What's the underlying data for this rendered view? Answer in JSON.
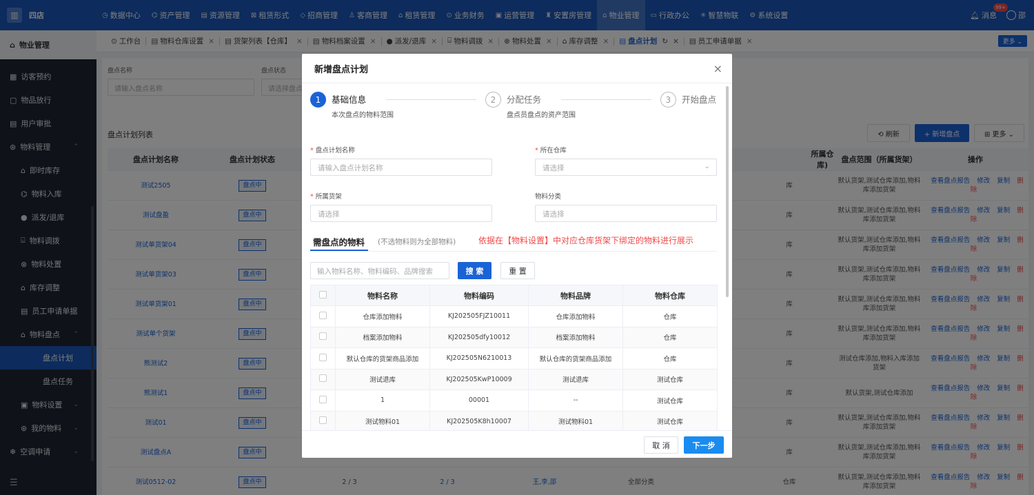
{
  "brand": {
    "name": "四店"
  },
  "topnav": [
    {
      "label": "数据中心",
      "icon": "◷"
    },
    {
      "label": "资产管理",
      "icon": "⌬"
    },
    {
      "label": "资源管理",
      "icon": "▤"
    },
    {
      "label": "租赁形式",
      "icon": "⊠"
    },
    {
      "label": "招商管理",
      "icon": "◇"
    },
    {
      "label": "客商管理",
      "icon": "♙"
    },
    {
      "label": "租赁管理",
      "icon": "⌂"
    },
    {
      "label": "业务财务",
      "icon": "⊙"
    },
    {
      "label": "运营管理",
      "icon": "▣"
    },
    {
      "label": "安置房管理",
      "icon": "♜"
    },
    {
      "label": "物业管理",
      "icon": "⌂",
      "active": true
    },
    {
      "label": "行政办公",
      "icon": "▭"
    },
    {
      "label": "智慧物联",
      "icon": "✳"
    },
    {
      "label": "系统设置",
      "icon": "⚙"
    }
  ],
  "topright": {
    "messages": "消息",
    "badge": "99+",
    "user": "邵"
  },
  "sidebar": {
    "title": "物业管理",
    "items": [
      {
        "label": "访客预约",
        "icon": "▦",
        "level": 1
      },
      {
        "label": "物品放行",
        "icon": "▢",
        "level": 1
      },
      {
        "label": "用户审批",
        "icon": "▤",
        "level": 1
      },
      {
        "label": "物料管理",
        "icon": "⊛",
        "level": 1,
        "caret": "⌃"
      },
      {
        "label": "即时库存",
        "icon": "⌂",
        "level": 2
      },
      {
        "label": "物料入库",
        "icon": "⌬",
        "level": 2
      },
      {
        "label": "派发/退库",
        "icon": "●",
        "level": 2
      },
      {
        "label": "物料调拨",
        "icon": "⌸",
        "level": 2
      },
      {
        "label": "物料处置",
        "icon": "⊗",
        "level": 2
      },
      {
        "label": "库存调整",
        "icon": "⌂",
        "level": 2
      },
      {
        "label": "员工申请单据",
        "icon": "▤",
        "level": 2
      },
      {
        "label": "物料盘点",
        "icon": "⌂",
        "level": 2,
        "caret": "⌃"
      },
      {
        "label": "盘点计划",
        "level": 3,
        "active": true
      },
      {
        "label": "盘点任务",
        "level": 3
      },
      {
        "label": "物料设置",
        "icon": "▣",
        "level": 2,
        "caret": "⌄"
      },
      {
        "label": "我的物料",
        "icon": "⊛",
        "level": 2,
        "caret": "⌄"
      },
      {
        "label": "空调申请",
        "icon": "❄",
        "level": 1,
        "caret": "⌄"
      }
    ]
  },
  "tabs": [
    {
      "label": "工作台",
      "icon": "⊙"
    },
    {
      "label": "物料仓库设置",
      "icon": "▤",
      "close": "×"
    },
    {
      "label": "货架列表【仓库】",
      "icon": "▤",
      "close": "×"
    },
    {
      "label": "物料档案设置",
      "icon": "▤",
      "close": "×"
    },
    {
      "label": "派发/退库",
      "icon": "●",
      "close": "×"
    },
    {
      "label": "物料调拨",
      "icon": "⌸",
      "close": "×"
    },
    {
      "label": "物料处置",
      "icon": "⊗",
      "close": "×"
    },
    {
      "label": "库存调整",
      "icon": "⌂",
      "close": "×"
    },
    {
      "label": "盘点计划",
      "icon": "▤",
      "close": "×",
      "active": true,
      "refresh": "↻"
    },
    {
      "label": "员工申请单据",
      "icon": "▤",
      "close": "×"
    }
  ],
  "more_tabs": "更多 ⌄",
  "filter": {
    "name_label": "盘点名称",
    "name_placeholder": "请输入盘点名称",
    "status_label": "盘点状态",
    "status_placeholder": "请选择盘点"
  },
  "list": {
    "title": "盘点计划列表",
    "refresh": "⟲ 刷新",
    "add": "+ 新增盘点",
    "more": "⊞ 更多 ⌄",
    "columns": [
      "盘点计划名称",
      "盘点计划状态",
      "",
      "",
      "",
      "",
      "",
      "",
      "所属仓库)",
      "盘点范围（所属货架）",
      "操作"
    ],
    "ops": {
      "report": "查看盘点报告",
      "edit": "修改",
      "copy": "复制",
      "delete": "删除"
    },
    "rows": [
      {
        "name": "测试2505",
        "status": "盘点中",
        "c3": "",
        "c4": "",
        "c5": "",
        "c6": "",
        "c7": "",
        "warehouse": "库",
        "range": "默认货架,测试仓库添加,物料库添加货架"
      },
      {
        "name": "测试盘盈",
        "status": "盘点中",
        "c3": "",
        "c4": "",
        "c5": "",
        "c6": "",
        "c7": "",
        "warehouse": "库",
        "range": "默认货架,测试仓库添加,物料库添加货架"
      },
      {
        "name": "测试单货架04",
        "status": "盘点中",
        "c3": "",
        "c4": "",
        "c5": "",
        "c6": "",
        "c7": "",
        "warehouse": "库",
        "range": "默认货架,测试仓库添加,物料库添加货架"
      },
      {
        "name": "测试单货架03",
        "status": "盘点中",
        "c3": "",
        "c4": "",
        "c5": "",
        "c6": "",
        "c7": "",
        "warehouse": "库",
        "range": "默认货架,测试仓库添加,物料库添加货架"
      },
      {
        "name": "测试单货架01",
        "status": "盘点中",
        "c3": "",
        "c4": "",
        "c5": "",
        "c6": "",
        "c7": "",
        "warehouse": "库",
        "range": "默认货架,测试仓库添加,物料库添加货架"
      },
      {
        "name": "测试单个货架",
        "status": "盘点中",
        "c3": "",
        "c4": "",
        "c5": "",
        "c6": "",
        "c7": "",
        "warehouse": "库",
        "range": "默认货架,测试仓库添加,物料库添加货架"
      },
      {
        "name": "熊测试2",
        "status": "盘点中",
        "c3": "",
        "c4": "",
        "c5": "",
        "c6": "",
        "c7": "",
        "warehouse": "库",
        "range": "测试仓库添加,物料入库添加货架"
      },
      {
        "name": "熊测试1",
        "status": "盘点中",
        "c3": "",
        "c4": "",
        "c5": "",
        "c6": "",
        "c7": "",
        "warehouse": "库",
        "range": "默认货架,测试仓库添加"
      },
      {
        "name": "测试01",
        "status": "盘点中",
        "c3": "",
        "c4": "",
        "c5": "",
        "c6": "",
        "c7": "",
        "warehouse": "库",
        "range": "默认货架,测试仓库添加,物料库添加货架"
      },
      {
        "name": "测试盘点A",
        "status": "盘点中",
        "c3": "",
        "c4": "",
        "c5": "",
        "c6": "",
        "c7": "",
        "warehouse": "库",
        "range": "默认货架,测试仓库添加,物料库添加货架"
      },
      {
        "name": "测试0512-02",
        "status": "盘点中",
        "c3": "2 / 3",
        "c4": "2 / 3",
        "c5": "王,李,邵",
        "c6": "全部分类",
        "c7": "",
        "warehouse": "仓库",
        "range": "默认货架,测试仓库添加,物料库添加货架"
      }
    ]
  },
  "modal": {
    "title": "新增盘点计划",
    "close": "×",
    "steps": [
      {
        "num": "1",
        "title": "基础信息",
        "desc": "本次盘点的物料范围"
      },
      {
        "num": "2",
        "title": "分配任务",
        "desc": "盘点员盘点的资产范围"
      },
      {
        "num": "3",
        "title": "开始盘点",
        "desc": ""
      }
    ],
    "form": {
      "name_label": "盘点计划名称",
      "name_placeholder": "请输入盘点计划名称",
      "warehouse_label": "所在仓库",
      "warehouse_placeholder": "请选择",
      "shelf_label": "所属货架",
      "shelf_placeholder": "请选择",
      "category_label": "物料分类",
      "category_placeholder": "请选择",
      "req": "*",
      "arrow": "⌄"
    },
    "section": {
      "title": "需盘点的物料",
      "sub": "(不选物料则为全部物料)",
      "note": "依据在【物料设置】中对应仓库货架下绑定的物料进行展示"
    },
    "search": {
      "placeholder": "输入物料名称、物料编码、品牌搜索",
      "search_btn": "搜 索",
      "reset_btn": "重 置"
    },
    "table": {
      "columns": [
        "物料名称",
        "物料编码",
        "物料品牌",
        "物料仓库"
      ],
      "rows": [
        [
          "仓库添加物料",
          "KJ202505FJZ10011",
          "仓库添加物料",
          "仓库"
        ],
        [
          "档案添加物料",
          "KJ202505dfy10012",
          "档案添加物料",
          "仓库"
        ],
        [
          "默认仓库的货架商品添加",
          "KJ202505N6210013",
          "默认仓库的货架商品添加",
          "仓库"
        ],
        [
          "测试退库",
          "KJ202505KwP10009",
          "测试退库",
          "测试仓库"
        ],
        [
          "1",
          "00001",
          "--",
          "测试仓库"
        ],
        [
          "测试物料01",
          "KJ202505K8h10007",
          "测试物料01",
          "测试仓库"
        ]
      ]
    },
    "footer": {
      "cancel": "取 消",
      "next": "下一步"
    }
  }
}
